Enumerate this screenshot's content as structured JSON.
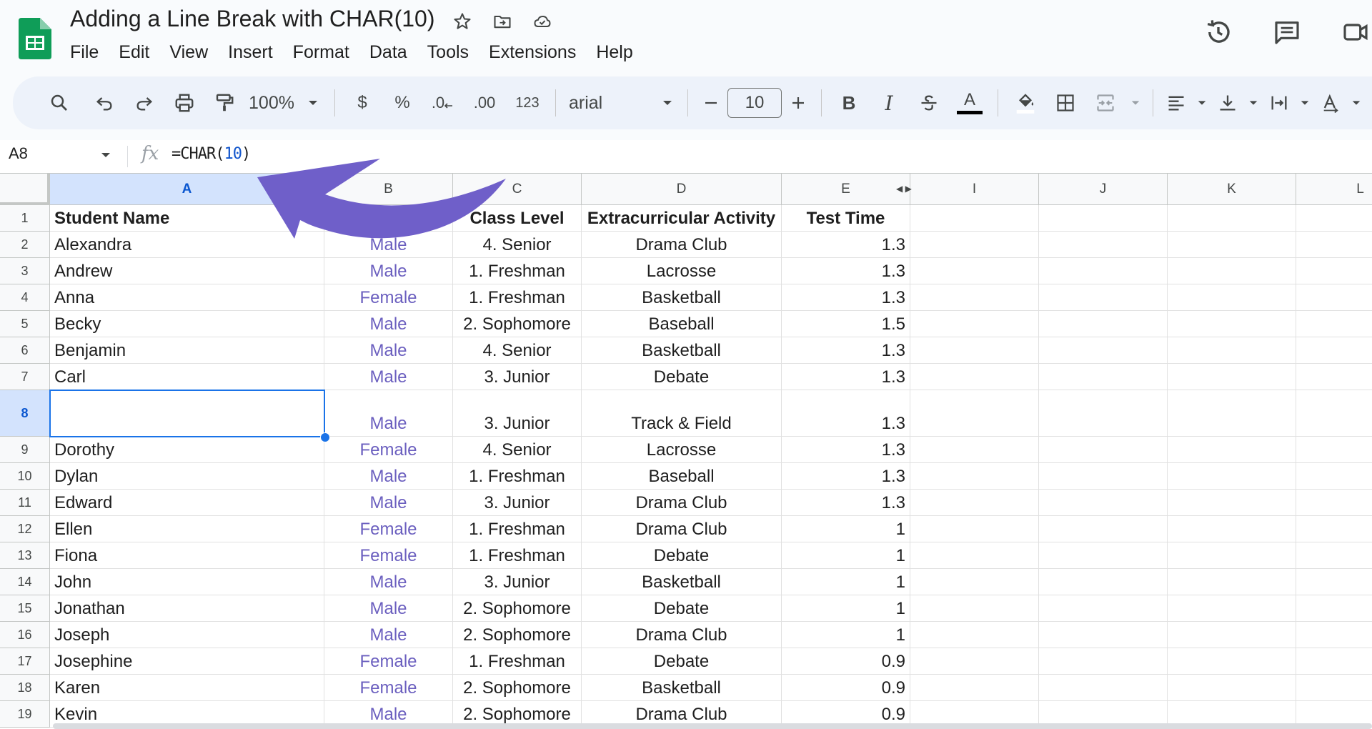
{
  "app": {
    "doc_title": "Adding a Line Break with CHAR(10)",
    "menu": [
      "File",
      "Edit",
      "View",
      "Insert",
      "Format",
      "Data",
      "Tools",
      "Extensions",
      "Help"
    ]
  },
  "toolbar": {
    "zoom": "100%",
    "currency": "$",
    "percent": "%",
    "dec_decrease": ".0",
    "dec_increase": ".00",
    "number_format": "123",
    "font": "arial",
    "font_size": "10",
    "bold": "B",
    "italic": "I",
    "text_color_letter": "A"
  },
  "formula_bar": {
    "cell_ref": "A8",
    "fx": "fx",
    "formula_prefix": "=CHAR(",
    "formula_arg": "10",
    "formula_suffix": ")"
  },
  "sheet": {
    "columns": [
      "A",
      "B",
      "C",
      "D",
      "E",
      "I",
      "J",
      "K",
      "L"
    ],
    "row_numbers": [
      "1",
      "2",
      "3",
      "4",
      "5",
      "6",
      "7",
      "8",
      "9",
      "10",
      "11",
      "12",
      "13",
      "14",
      "15",
      "16",
      "17",
      "18",
      "19"
    ],
    "header_row": [
      "Student Name",
      "",
      "Class Level",
      "Extracurricular Activity",
      "Test Time"
    ],
    "rows": [
      [
        "Alexandra",
        "Male",
        "4. Senior",
        "Drama Club",
        "1.3"
      ],
      [
        "Andrew",
        "Male",
        "1. Freshman",
        "Lacrosse",
        "1.3"
      ],
      [
        "Anna",
        "Female",
        "1. Freshman",
        "Basketball",
        "1.3"
      ],
      [
        "Becky",
        "Male",
        "2. Sophomore",
        "Baseball",
        "1.5"
      ],
      [
        "Benjamin",
        "Male",
        "4. Senior",
        "Basketball",
        "1.3"
      ],
      [
        "Carl",
        "Male",
        "3. Junior",
        "Debate",
        "1.3"
      ],
      [
        "",
        "Male",
        "3. Junior",
        "Track & Field",
        "1.3"
      ],
      [
        "Dorothy",
        "Female",
        "4. Senior",
        "Lacrosse",
        "1.3"
      ],
      [
        "Dylan",
        "Male",
        "1. Freshman",
        "Baseball",
        "1.3"
      ],
      [
        "Edward",
        "Male",
        "3. Junior",
        "Drama Club",
        "1.3"
      ],
      [
        "Ellen",
        "Female",
        "1. Freshman",
        "Drama Club",
        "1"
      ],
      [
        "Fiona",
        "Female",
        "1. Freshman",
        "Debate",
        "1"
      ],
      [
        "John",
        "Male",
        "3. Junior",
        "Basketball",
        "1"
      ],
      [
        "Jonathan",
        "Male",
        "2. Sophomore",
        "Debate",
        "1"
      ],
      [
        "Joseph",
        "Male",
        "2. Sophomore",
        "Drama Club",
        "1"
      ],
      [
        "Josephine",
        "Female",
        "1. Freshman",
        "Debate",
        "0.9"
      ],
      [
        "Karen",
        "Female",
        "2. Sophomore",
        "Basketball",
        "0.9"
      ],
      [
        "Kevin",
        "Male",
        "2. Sophomore",
        "Drama Club",
        "0.9"
      ]
    ],
    "selected_cell": "A8"
  },
  "colors": {
    "accent": "#1a73e8",
    "annotation_arrow": "#6f5fc9",
    "gender_text": "#6b5fbf",
    "sheets_green": "#0f9d58"
  }
}
